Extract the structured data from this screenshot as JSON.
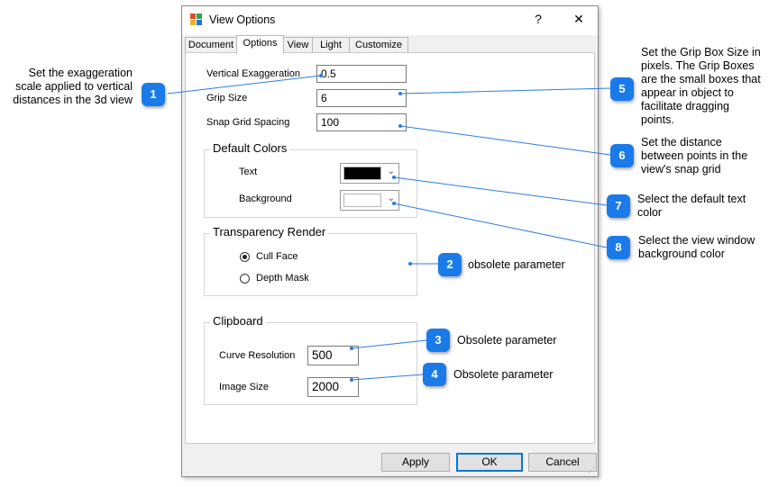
{
  "window": {
    "title": "View Options",
    "help_glyph": "?",
    "close_glyph": "✕"
  },
  "tabs": [
    {
      "label": "Document"
    },
    {
      "label": "Options"
    },
    {
      "label": "View"
    },
    {
      "label": "Light"
    },
    {
      "label": "Customize"
    }
  ],
  "fields": {
    "vertical_exaggeration": {
      "label": "Vertical Exaggeration",
      "value": "0.5"
    },
    "grip_size": {
      "label": "Grip Size",
      "value": "6"
    },
    "snap_grid_spacing": {
      "label": "Snap Grid Spacing",
      "value": "100"
    }
  },
  "default_colors": {
    "title": "Default Colors",
    "text_label": "Text",
    "background_label": "Background",
    "text_color": "#000000",
    "background_color": "#ffffff"
  },
  "transparency": {
    "title": "Transparency Render",
    "options": [
      {
        "label": "Cull Face",
        "checked": true
      },
      {
        "label": "Depth Mask",
        "checked": false
      }
    ]
  },
  "clipboard": {
    "title": "Clipboard",
    "curve_resolution": {
      "label": "Curve Resolution",
      "value": "500"
    },
    "image_size": {
      "label": "Image Size",
      "value": "2000"
    }
  },
  "buttons": {
    "apply": "Apply",
    "ok": "OK",
    "cancel": "Cancel"
  },
  "callouts": [
    {
      "number": "1",
      "text": "Set the exaggeration scale applied to vertical distances in the 3d view"
    },
    {
      "number": "2",
      "text": "obsolete parameter"
    },
    {
      "number": "3",
      "text": "Obsolete parameter"
    },
    {
      "number": "4",
      "text": "Obsolete parameter"
    },
    {
      "number": "5",
      "text": "Set the Grip Box Size in pixels.  The Grip Boxes are the small boxes that appear in object to facilitate dragging points."
    },
    {
      "number": "6",
      "text": "Set the distance between points in the view's snap grid"
    },
    {
      "number": "7",
      "text": "Select the default text color"
    },
    {
      "number": "8",
      "text": "Select the view window background color"
    }
  ],
  "colors": {
    "accent": "#1a7be8",
    "leader": "#2a7de1"
  }
}
